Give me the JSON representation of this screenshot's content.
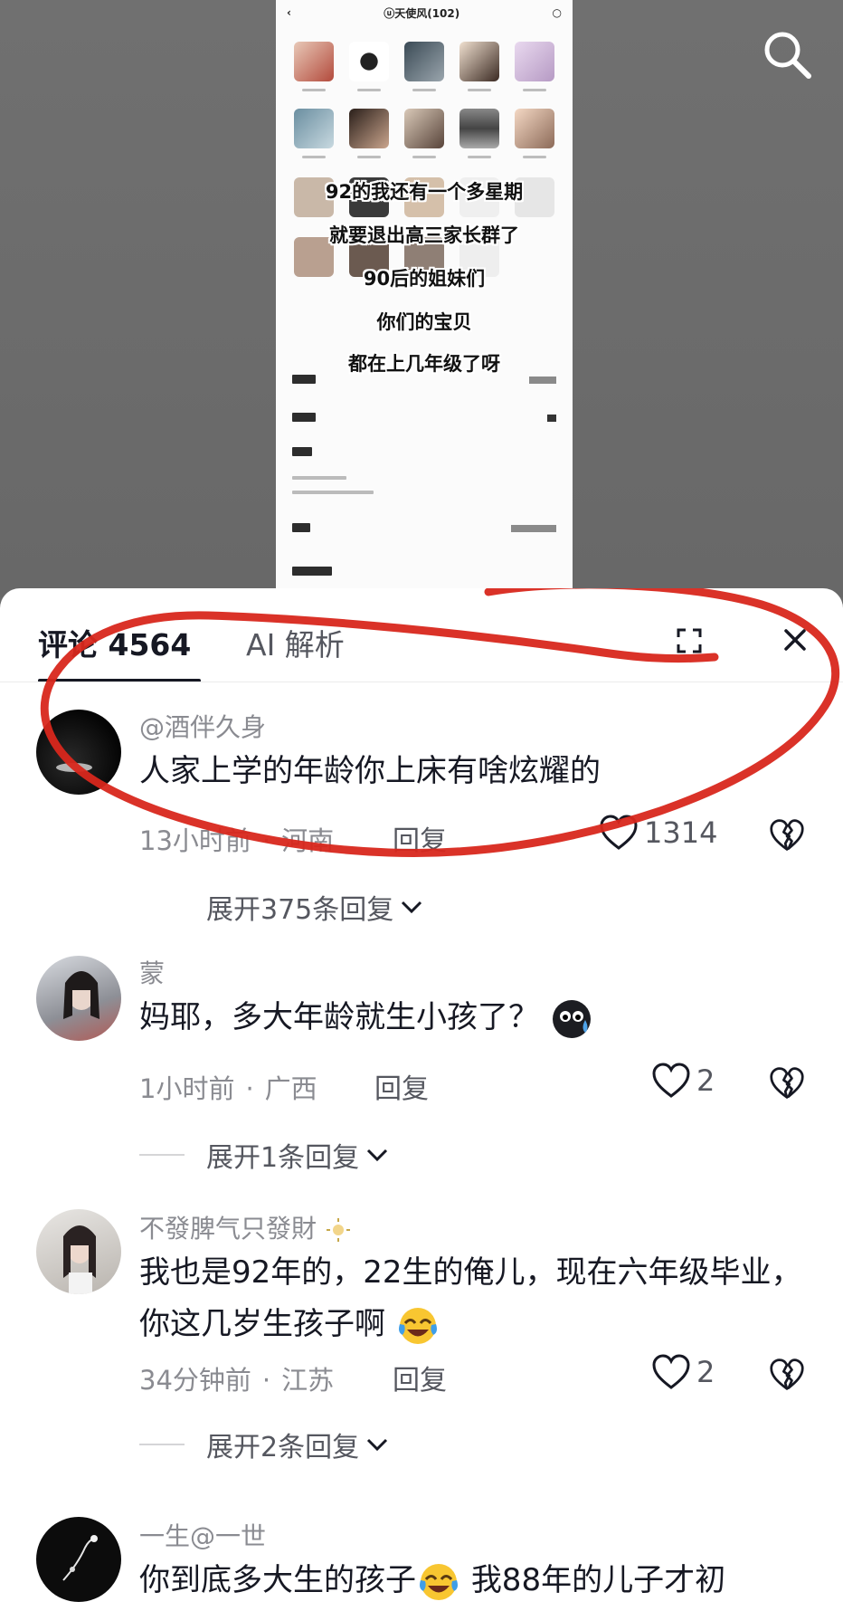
{
  "video": {
    "phone_title": "ⓤ天使风(102)",
    "overlay_lines": [
      "92的我还有一个多星期",
      "就要退出高三家长群了",
      "90后的姐妹们",
      "你们的宝贝",
      "都在上几年级了呀"
    ]
  },
  "tabs": {
    "comments_label": "评论 4564",
    "ai_label": "AI 解析"
  },
  "comments": [
    {
      "username": "@酒伴久身",
      "text": "人家上学的年龄你上床有啥炫耀的",
      "time": "13小时前",
      "location": "河南",
      "reply_label": "回复",
      "likes": "1314",
      "expand": "展开375条回复"
    },
    {
      "username": "蒙",
      "text": "妈耶，多大年龄就生小孩了？",
      "time": "1小时前",
      "location": "广西",
      "reply_label": "回复",
      "likes": "2",
      "expand": "展开1条回复"
    },
    {
      "username": "不發脾气只發財",
      "text": "我也是92年的，22生的俺儿，现在六年级毕业，你这几岁生孩子啊",
      "time": "34分钟前",
      "location": "江苏",
      "reply_label": "回复",
      "likes": "2",
      "expand": "展开2条回复"
    },
    {
      "username": "一生@一世",
      "text_a": "你到底多大生的孩子",
      "text_b": "我88年的儿子才初"
    }
  ],
  "colors": {
    "annotation_red": "#d8271c",
    "text_primary": "#161823",
    "text_secondary": "#8a8b91"
  }
}
